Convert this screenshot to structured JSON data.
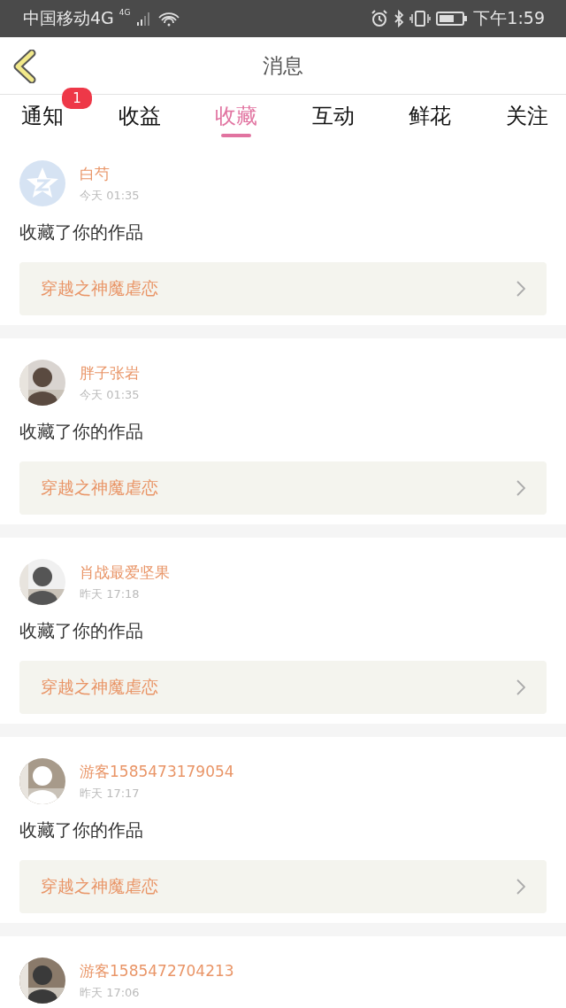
{
  "status_bar": {
    "carrier": "中国移动4G",
    "network": "4G",
    "time": "下午1:59"
  },
  "header": {
    "title": "消息"
  },
  "tabs": [
    {
      "label": "通知",
      "selected": false,
      "badge": "1"
    },
    {
      "label": "收益",
      "selected": false
    },
    {
      "label": "收藏",
      "selected": true
    },
    {
      "label": "互动",
      "selected": false
    },
    {
      "label": "鲜花",
      "selected": false
    },
    {
      "label": "关注",
      "selected": false
    }
  ],
  "messages": [
    {
      "kind": "default",
      "name": "白芍",
      "time": "今天 01:35",
      "text": "收藏了你的作品",
      "work": "穿越之神魔虐恋"
    },
    {
      "kind": "picture",
      "name": "胖子张岩",
      "time": "今天 01:35",
      "text": "收藏了你的作品",
      "work": "穿越之神魔虐恋"
    },
    {
      "kind": "picture",
      "name": "肖战最爱坚果",
      "time": "昨天 17:18",
      "text": "收藏了你的作品",
      "work": "穿越之神魔虐恋"
    },
    {
      "kind": "picture",
      "name": "游客1585473179054",
      "time": "昨天 17:17",
      "text": "收藏了你的作品",
      "work": "穿越之神魔虐恋"
    },
    {
      "kind": "picture",
      "name": "游客1585472704213",
      "time": "昨天 17:06"
    }
  ]
}
